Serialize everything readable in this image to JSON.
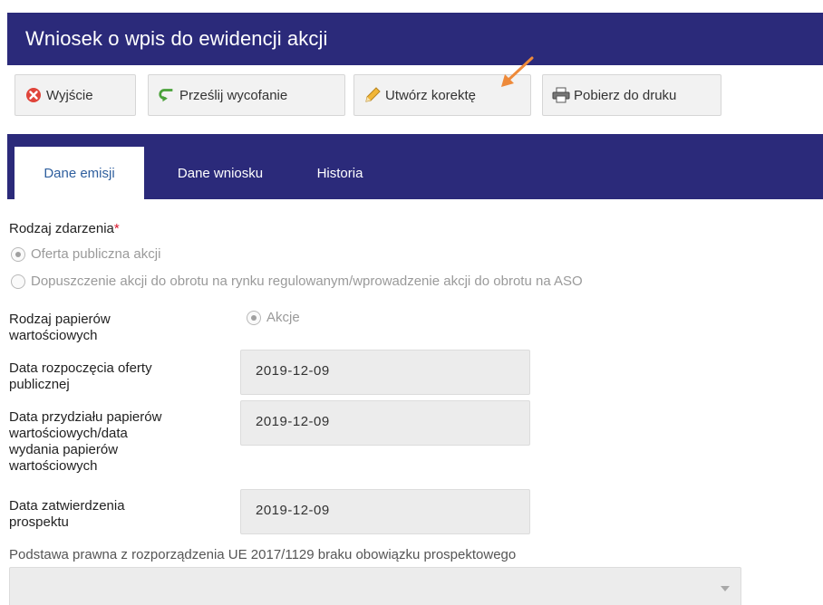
{
  "window": {
    "title": "Wniosek o wpis do ewidencji akcji"
  },
  "toolbar": {
    "exit_label": "Wyjście",
    "withdraw_label": "Prześlij wycofanie",
    "correct_label": "Utwórz korektę",
    "print_label": "Pobierz do druku"
  },
  "tabs": [
    {
      "label": "Dane emisji",
      "active": true
    },
    {
      "label": "Dane wniosku",
      "active": false
    },
    {
      "label": "Historia",
      "active": false
    }
  ],
  "form": {
    "event_type": {
      "label": "Rodzaj zdarzenia",
      "required_mark": "*",
      "options": [
        {
          "label": "Oferta publiczna akcji",
          "checked": true
        },
        {
          "label": "Dopuszczenie akcji do obrotu na rynku regulowanym/wprowadzenie akcji do obrotu na ASO",
          "checked": false
        }
      ]
    },
    "securities_type": {
      "label_line1": "Rodzaj papierów",
      "label_line2": "wartościowych",
      "option": "Akcje"
    },
    "offer_start": {
      "label_line1": "Data rozpoczęcia oferty",
      "label_line2": "publicznej",
      "value": "2019-12-09"
    },
    "allotment_date": {
      "label_line1": "Data przydziału papierów",
      "label_line2": "wartościowych/data",
      "label_line3": "wydania papierów",
      "label_line4": "wartościowych",
      "value": "2019-12-09"
    },
    "prospectus_date": {
      "label_line1": "Data zatwierdzenia",
      "label_line2": "prospektu",
      "value": "2019-12-09"
    },
    "legal_basis": {
      "label": "Podstawa prawna z rozporządzenia UE 2017/1129 braku obowiązku prospektowego",
      "value": ""
    }
  },
  "colors": {
    "header_bg": "#2b2a7a",
    "active_tab_text": "#2f5f9e",
    "required": "#d9162b",
    "annotation_arrow": "#ee8a3a"
  }
}
